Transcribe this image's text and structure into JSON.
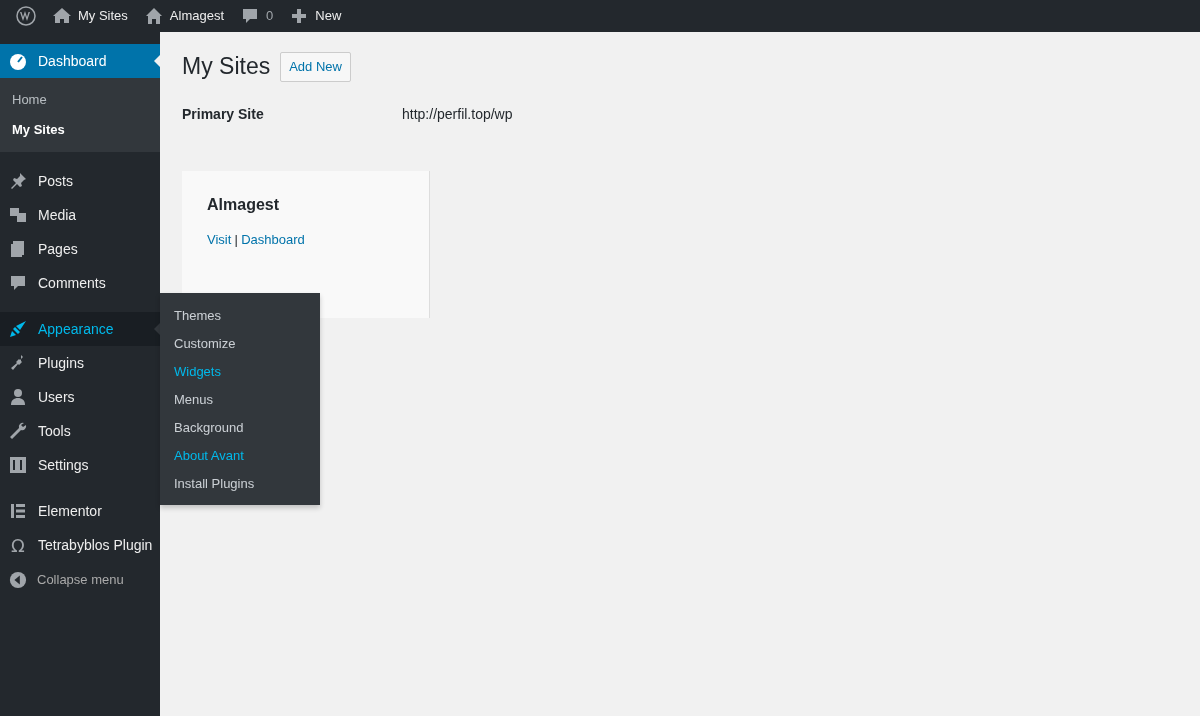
{
  "admin_bar": {
    "items": [
      {
        "label": "My Sites"
      },
      {
        "label": "Almagest"
      },
      {
        "label": "0"
      },
      {
        "label": "New"
      }
    ]
  },
  "sidebar": {
    "groups": [
      [
        {
          "label": "Dashboard",
          "selected": true,
          "hovered": false,
          "children": [
            {
              "label": "Home",
              "selected": false
            },
            {
              "label": "My Sites",
              "selected": true
            }
          ]
        }
      ],
      [
        {
          "label": "Posts",
          "selected": false,
          "hovered": false
        },
        {
          "label": "Media",
          "selected": false,
          "hovered": false
        },
        {
          "label": "Pages",
          "selected": false,
          "hovered": false
        },
        {
          "label": "Comments",
          "selected": false,
          "hovered": false
        }
      ],
      [
        {
          "label": "Appearance",
          "selected": false,
          "hovered": true,
          "flyout": [
            {
              "label": "Themes",
              "highlighted": false
            },
            {
              "label": "Customize",
              "highlighted": false
            },
            {
              "label": "Widgets",
              "highlighted": true
            },
            {
              "label": "Menus",
              "highlighted": false
            },
            {
              "label": "Background",
              "highlighted": false
            },
            {
              "label": "About Avant",
              "highlighted": true
            },
            {
              "label": "Install Plugins",
              "highlighted": false
            }
          ]
        },
        {
          "label": "Plugins",
          "selected": false,
          "hovered": false
        },
        {
          "label": "Users",
          "selected": false,
          "hovered": false
        },
        {
          "label": "Tools",
          "selected": false,
          "hovered": false
        },
        {
          "label": "Settings",
          "selected": false,
          "hovered": false
        }
      ],
      [
        {
          "label": "Elementor",
          "selected": false,
          "hovered": false
        },
        {
          "label": "Tetrabyblos Plugin",
          "selected": false,
          "hovered": false,
          "glyph": "Ω"
        }
      ]
    ],
    "collapse": "Collapse menu"
  },
  "page": {
    "title": "My Sites",
    "add_button": "Add New",
    "primary_site": {
      "label": "Primary Site",
      "value": "http://perfil.top/wp"
    },
    "sites": [
      {
        "name": "Almagest",
        "links": [
          "Visit",
          "Dashboard"
        ],
        "separator": "|"
      }
    ]
  }
}
